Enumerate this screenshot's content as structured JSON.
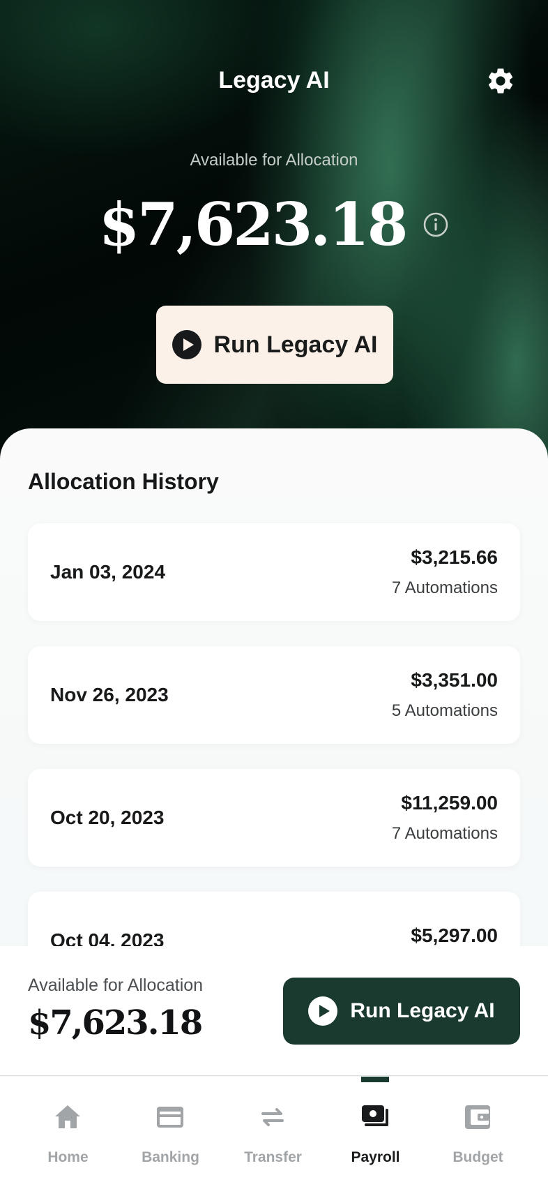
{
  "header": {
    "title": "Legacy AI"
  },
  "hero": {
    "label": "Available for Allocation",
    "amount": "$7,623.18",
    "run_button_label": "Run Legacy AI"
  },
  "history": {
    "title": "Allocation History",
    "items": [
      {
        "date": "Jan 03, 2024",
        "amount": "$3,215.66",
        "automations": "7 Automations"
      },
      {
        "date": "Nov 26, 2023",
        "amount": "$3,351.00",
        "automations": "5 Automations"
      },
      {
        "date": "Oct 20, 2023",
        "amount": "$11,259.00",
        "automations": "7 Automations"
      },
      {
        "date": "Oct 04, 2023",
        "amount": "$5,297.00",
        "automations": ""
      }
    ]
  },
  "allocation_bar": {
    "label": "Available for Allocation",
    "amount": "$7,623.18",
    "run_button_label": "Run Legacy AI"
  },
  "tabbar": {
    "items": [
      {
        "label": "Home",
        "icon": "home-icon",
        "active": false
      },
      {
        "label": "Banking",
        "icon": "credit-card-icon",
        "active": false
      },
      {
        "label": "Transfer",
        "icon": "transfer-arrows-icon",
        "active": false
      },
      {
        "label": "Payroll",
        "icon": "payroll-cash-icon",
        "active": true
      },
      {
        "label": "Budget",
        "icon": "wallet-icon",
        "active": false
      }
    ]
  },
  "colors": {
    "brand_dark_green": "#1a3a30",
    "hero_button_bg": "#fcf1e9",
    "tab_inactive": "#a2a5a8",
    "tab_active": "#191b1c"
  }
}
